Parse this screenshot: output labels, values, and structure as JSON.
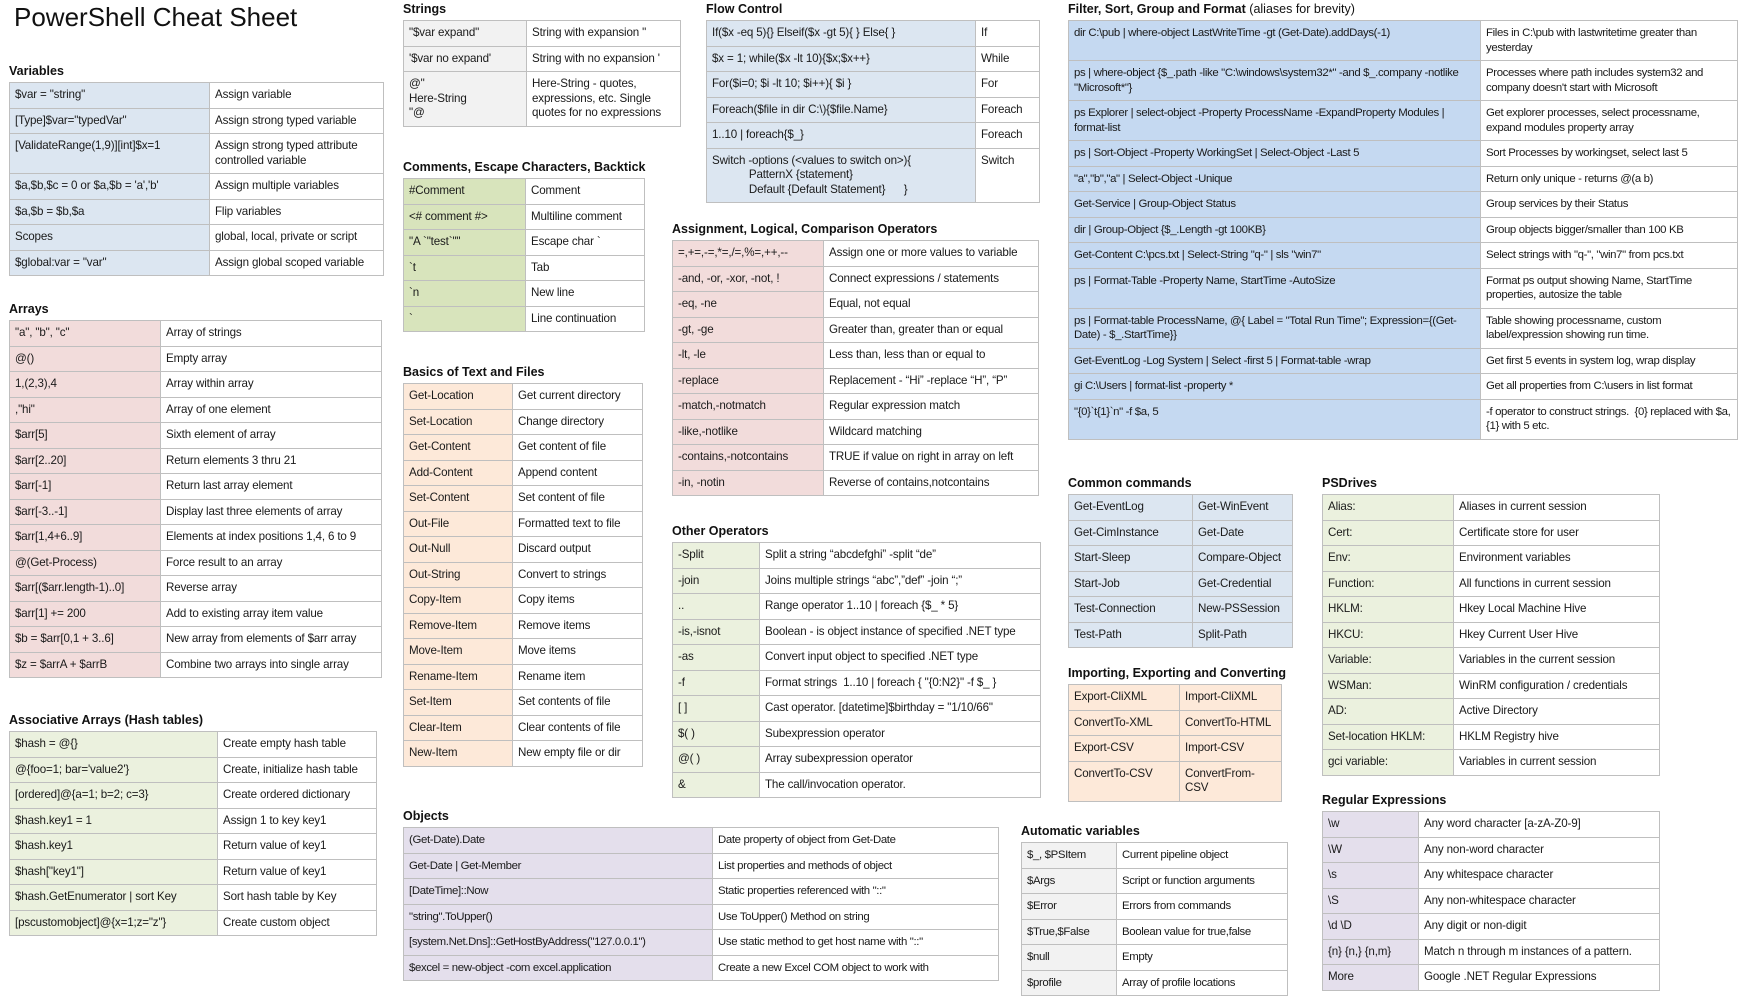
{
  "title": "PowerShell Cheat Sheet",
  "colors": {
    "blue": "#dce6f1",
    "blue_strong": "#c5d9f1",
    "pink": "#f2dcdb",
    "gray": "#f2f2f2",
    "green": "#d8e4bc",
    "light_green": "#ebf1de",
    "orange": "#fde9d9",
    "purple": "#e4dfec",
    "border": "#bfbfbf"
  },
  "sections": {
    "variables": {
      "title": "Variables",
      "rows": [
        [
          "$var = \"string\"",
          "Assign variable"
        ],
        [
          "[Type]$var=\"typedVar\"",
          "Assign strong typed variable"
        ],
        [
          "[ValidateRange(1,9)][int]$x=1",
          "Assign strong typed attribute controlled variable"
        ],
        [
          "$a,$b,$c = 0 or $a,$b = 'a','b'",
          "Assign multiple variables"
        ],
        [
          "$a,$b = $b,$a",
          "Flip variables"
        ],
        [
          "Scopes",
          "global, local, private or script"
        ],
        [
          "$global:var = \"var\"",
          "Assign global scoped variable"
        ]
      ]
    },
    "arrays": {
      "title": "Arrays",
      "rows": [
        [
          "\"a\", \"b\", \"c\"",
          "Array of strings"
        ],
        [
          "@()",
          "Empty array"
        ],
        [
          "1,(2,3),4",
          "Array within array"
        ],
        [
          ",\"hi\"",
          "Array of one element"
        ],
        [
          "$arr[5]",
          "Sixth element of array"
        ],
        [
          "$arr[2..20]",
          "Return elements 3 thru 21"
        ],
        [
          "$arr[-1]",
          "Return last array element"
        ],
        [
          "$arr[-3..-1]",
          "Display last three elements of array"
        ],
        [
          "$arr[1,4+6..9]",
          "Elements at index positions 1,4, 6 to 9"
        ],
        [
          "@(Get-Process)",
          "Force result to an array"
        ],
        [
          "$arr[($arr.length-1)..0]",
          "Reverse array"
        ],
        [
          "$arr[1] += 200",
          "Add to existing array item value"
        ],
        [
          "$b = $arr[0,1 + 3..6]",
          "New array from elements of $arr array"
        ],
        [
          "$z = $arrA + $arrB",
          "Combine two arrays into single array"
        ]
      ]
    },
    "hash_tables": {
      "title": "Associative Arrays (Hash tables)",
      "rows": [
        [
          "$hash = @{}",
          "Create empty hash table"
        ],
        [
          "@{foo=1; bar='value2'}",
          "Create, initialize hash table"
        ],
        [
          "[ordered]@{a=1; b=2; c=3}",
          "Create ordered dictionary"
        ],
        [
          "$hash.key1 = 1",
          "Assign 1 to key key1"
        ],
        [
          "$hash.key1",
          "Return value of key1"
        ],
        [
          "$hash[\"key1\"]",
          "Return value of key1"
        ],
        [
          "$hash.GetEnumerator | sort Key",
          "Sort hash table by Key"
        ],
        [
          "[pscustomobject]@{x=1;z=\"z\"}",
          "Create custom object"
        ]
      ]
    },
    "strings": {
      "title": "Strings",
      "rows": [
        [
          "\"$var expand\"",
          "String with expansion \""
        ],
        [
          "'$var no expand'",
          "String with no expansion '"
        ],
        [
          "@\"\nHere-String\n\"@",
          "Here-String - quotes, expressions, etc. Single quotes for no expressions"
        ]
      ]
    },
    "comments": {
      "title": "Comments, Escape Characters, Backtick",
      "rows": [
        [
          "#Comment",
          "Comment"
        ],
        [
          "<# comment #>",
          "Multiline comment"
        ],
        [
          "\"A `\"test`\"\"",
          "Escape char `"
        ],
        [
          "`t",
          "Tab"
        ],
        [
          "`n",
          "New line"
        ],
        [
          "`",
          "Line continuation"
        ]
      ]
    },
    "basics": {
      "title": "Basics of Text and Files",
      "rows": [
        [
          "Get-Location",
          "Get current directory"
        ],
        [
          "Set-Location",
          "Change directory"
        ],
        [
          "Get-Content",
          "Get content of file"
        ],
        [
          "Add-Content",
          "Append content"
        ],
        [
          "Set-Content",
          "Set content of file"
        ],
        [
          "Out-File",
          "Formatted text to file"
        ],
        [
          "Out-Null",
          "Discard output"
        ],
        [
          "Out-String",
          "Convert to strings"
        ],
        [
          "Copy-Item",
          "Copy items"
        ],
        [
          "Remove-Item",
          "Remove items"
        ],
        [
          "Move-Item",
          "Move items"
        ],
        [
          "Rename-Item",
          "Rename item"
        ],
        [
          "Set-Item",
          "Set contents of file"
        ],
        [
          "Clear-Item",
          "Clear contents of file"
        ],
        [
          "New-Item",
          "New empty file or dir"
        ]
      ]
    },
    "objects": {
      "title": "Objects",
      "rows": [
        [
          "(Get-Date).Date",
          "Date property of object from Get-Date"
        ],
        [
          "Get-Date | Get-Member",
          "List properties and methods of object"
        ],
        [
          "[DateTime]::Now",
          "Static properties referenced with \"::\""
        ],
        [
          "\"string\".ToUpper()",
          "Use ToUpper() Method on string"
        ],
        [
          "[system.Net.Dns]::GetHostByAddress(\"127.0.0.1\")",
          "Use static method to get host name with \"::\""
        ],
        [
          "$excel = new-object -com excel.application",
          "Create a new Excel COM object to work with"
        ]
      ]
    },
    "flow_control": {
      "title": "Flow Control",
      "rows": [
        [
          "If($x -eq 5){} Elseif($x -gt 5){ } Else{ }",
          "If"
        ],
        [
          "$x = 1; while($x -lt 10){$x;$x++}",
          "While"
        ],
        [
          "For($i=0; $i -lt 10; $i++){ $i }",
          "For"
        ],
        [
          "Foreach($file in dir C:\\){$file.Name}",
          "Foreach"
        ],
        [
          "1..10 | foreach{$_}",
          "Foreach"
        ],
        [
          "Switch -options (<values to switch on>){\n            PatternX {statement}\n            Default {Default Statement}      }",
          "Switch"
        ]
      ]
    },
    "operators": {
      "title": "Assignment, Logical, Comparison Operators",
      "rows": [
        [
          "=,+=,-=,*=,/=,%=,++,--",
          "Assign one or more values to variable"
        ],
        [
          "-and, -or, -xor, -not, !",
          "Connect expressions / statements"
        ],
        [
          "-eq, -ne",
          "Equal, not equal"
        ],
        [
          "-gt, -ge",
          "Greater than, greater than or equal"
        ],
        [
          "-lt, -le",
          "Less than, less than or equal to"
        ],
        [
          "-replace",
          "Replacement - “Hi” -replace “H”, “P”"
        ],
        [
          "-match,-notmatch",
          "Regular expression match"
        ],
        [
          "-like,-notlike",
          "Wildcard matching"
        ],
        [
          "-contains,-notcontains",
          "TRUE if value on right in array on left"
        ],
        [
          "-in, -notin",
          "Reverse of contains,notcontains"
        ]
      ]
    },
    "other_operators": {
      "title": "Other Operators",
      "rows": [
        [
          "-Split",
          "Split a string “abcdefghi” -split “de”"
        ],
        [
          "-join",
          "Joins multiple strings “abc”,”def” -join “;”"
        ],
        [
          "..",
          "Range operator 1..10 | foreach {$_ * 5}"
        ],
        [
          "-is,-isnot",
          "Boolean - is object instance of specified .NET type"
        ],
        [
          "-as",
          "Convert input object to specified .NET type"
        ],
        [
          "-f",
          "Format strings  1..10 | foreach { \"{0:N2}\" -f $_ }"
        ],
        [
          "[ ]",
          "Cast operator. [datetime]$birthday = \"1/10/66\""
        ],
        [
          "$( )",
          "Subexpression operator"
        ],
        [
          "@( )",
          "Array subexpression operator"
        ],
        [
          "&",
          "The call/invocation operator."
        ]
      ]
    },
    "automatic_variables": {
      "title": "Automatic variables",
      "rows": [
        [
          "$_, $PSItem",
          "Current pipeline object"
        ],
        [
          "$Args",
          "Script or function arguments"
        ],
        [
          "$Error",
          "Errors from commands"
        ],
        [
          "$True,$False",
          "Boolean value for true,false"
        ],
        [
          "$null",
          "Empty"
        ],
        [
          "$profile",
          "Array of profile locations"
        ]
      ]
    },
    "filter": {
      "title": "Filter, Sort, Group and Format",
      "subtitle": "(aliases for brevity)",
      "rows": [
        [
          "dir C:\\pub | where-object LastWriteTime -gt (Get-Date).addDays(-1)",
          "Files in C:\\pub with lastwritetime greater than yesterday"
        ],
        [
          "ps | where-object {$_.path -like \"C:\\windows\\system32*\" -and $_.company -notlike \"Microsoft*\"}",
          "Processes where path includes system32 and company doesn't start with Microsoft"
        ],
        [
          "ps Explorer | select-object -Property ProcessName -ExpandProperty Modules | format-list",
          "Get explorer processes, select processname, expand modules property array"
        ],
        [
          "ps | Sort-Object -Property WorkingSet | Select-Object -Last 5",
          "Sort Processes by workingset, select last 5"
        ],
        [
          "\"a\",\"b\",\"a\" | Select-Object -Unique",
          "Return only unique - returns @(a b)"
        ],
        [
          "Get-Service | Group-Object Status",
          "Group services by their Status"
        ],
        [
          "dir | Group-Object {$_.Length -gt 100KB}",
          "Group objects bigger/smaller than 100 KB"
        ],
        [
          "Get-Content C:\\pcs.txt | Select-String \"q-\" | sls \"win7\"",
          "Select strings with \"q-\", \"win7\" from pcs.txt"
        ],
        [
          "ps | Format-Table -Property Name, StartTime -AutoSize",
          "Format ps output showing Name, StartTime properties, autosize the table"
        ],
        [
          "ps | Format-table ProcessName, @{ Label = \"Total Run Time\"; Expression={(Get-Date) - $_.StartTime}}",
          "Table showing processname, custom label/expression showing run time."
        ],
        [
          "Get-EventLog -Log System | Select -first 5 | Format-table -wrap",
          "Get first 5 events in system log, wrap display"
        ],
        [
          "gi C:\\Users | format-list -property *",
          "Get all properties from C:\\users in list format"
        ],
        [
          "\"{0}`t{1}`n\" -f $a, 5",
          "-f operator to construct strings.  {0} replaced with $a, {1} with 5 etc."
        ]
      ]
    },
    "common_commands": {
      "title": "Common commands",
      "rows": [
        [
          "Get-EventLog",
          "Get-WinEvent"
        ],
        [
          "Get-CimInstance",
          "Get-Date"
        ],
        [
          "Start-Sleep",
          "Compare-Object"
        ],
        [
          "Start-Job",
          "Get-Credential"
        ],
        [
          "Test-Connection",
          "New-PSSession"
        ],
        [
          "Test-Path",
          "Split-Path"
        ]
      ]
    },
    "importing": {
      "title": "Importing, Exporting and Converting",
      "rows": [
        [
          "Export-CliXML",
          "Import-CliXML"
        ],
        [
          "ConvertTo-XML",
          "ConvertTo-HTML"
        ],
        [
          "Export-CSV",
          "Import-CSV"
        ],
        [
          "ConvertTo-CSV",
          "ConvertFrom-CSV"
        ]
      ]
    },
    "psdrives": {
      "title": "PSDrives",
      "rows": [
        [
          "Alias:",
          "Aliases in current session"
        ],
        [
          "Cert:",
          "Certificate store for user"
        ],
        [
          "Env:",
          "Environment variables"
        ],
        [
          "Function:",
          "All functions in current session"
        ],
        [
          "HKLM:",
          "Hkey Local Machine Hive"
        ],
        [
          "HKCU:",
          "Hkey Current User Hive"
        ],
        [
          "Variable:",
          "Variables in the current session"
        ],
        [
          "WSMan:",
          "WinRM configuration / credentials"
        ],
        [
          "AD:",
          "Active Directory"
        ],
        [
          "Set-location HKLM:",
          "HKLM Registry hive"
        ],
        [
          "gci variable:",
          "Variables in current session"
        ]
      ]
    },
    "regex": {
      "title": "Regular Expressions",
      "rows": [
        [
          "\\w",
          "Any word character [a-zA-Z0-9]"
        ],
        [
          "\\W",
          "Any non-word character"
        ],
        [
          "\\s",
          "Any whitespace character"
        ],
        [
          "\\S",
          "Any non-whitespace character"
        ],
        [
          "\\d \\D",
          "Any digit or non-digit"
        ],
        [
          "{n} {n,} {n,m}",
          "Match n through m instances of a pattern."
        ],
        [
          "More",
          "Google .NET Regular Expressions"
        ]
      ]
    }
  }
}
